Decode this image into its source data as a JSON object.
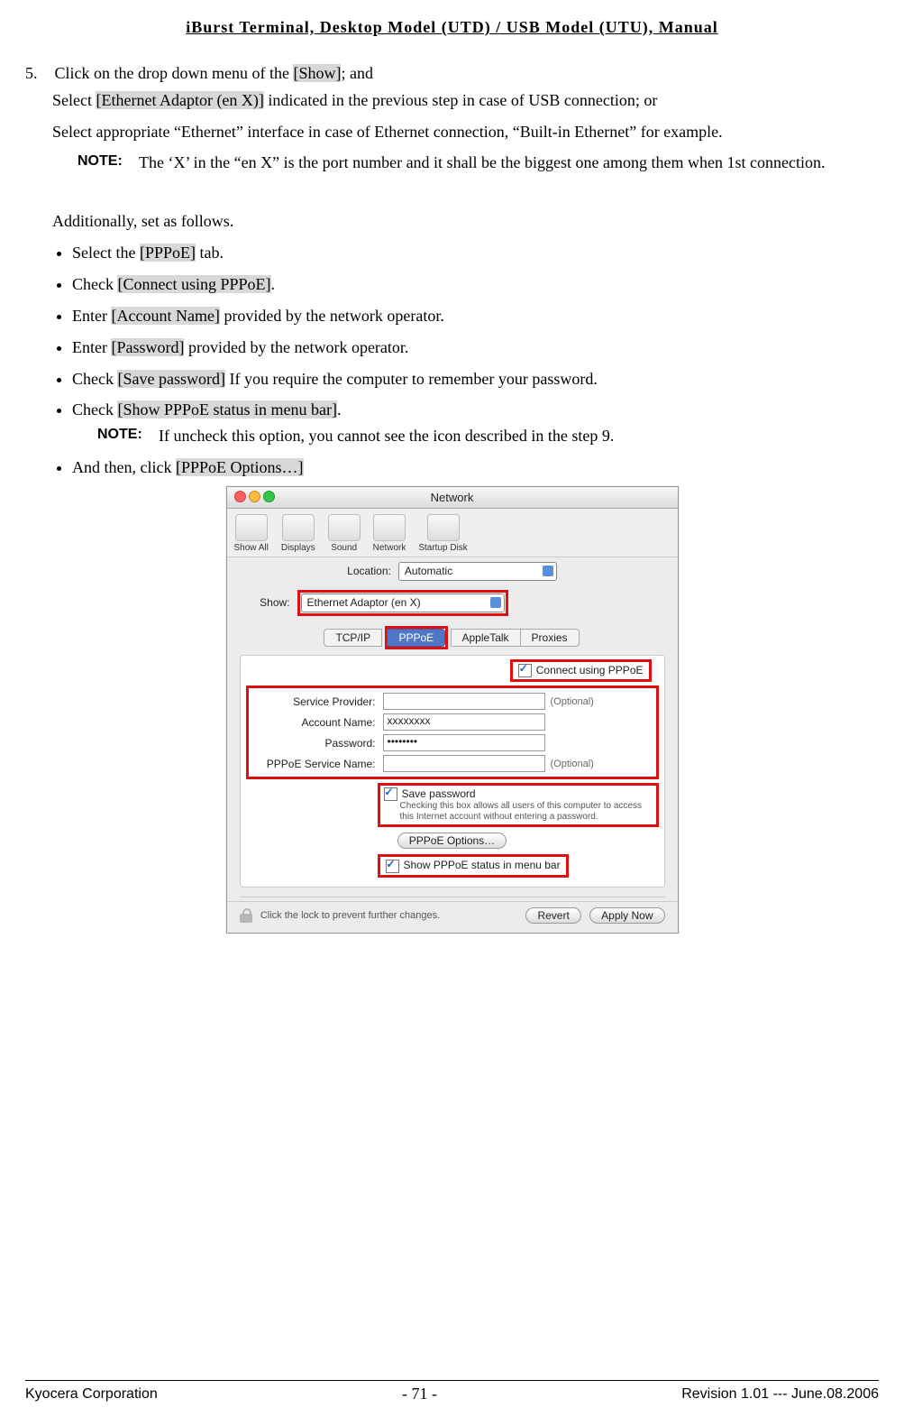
{
  "header": "iBurst Terminal, Desktop Model (UTD) / USB Model (UTU), Manual",
  "step_number": "5.",
  "step_text_1a": "Click on the drop down menu of the ",
  "step_text_1b": "[Show]",
  "step_text_1c": "; and",
  "step_text_2a": "Select ",
  "step_text_2b": "[Ethernet Adaptor (en X)]",
  "step_text_2c": " indicated in the previous step in case of USB connection; or",
  "step_text_3": "Select appropriate “Ethernet” interface in case of Ethernet connection, “Built-in Ethernet” for example.",
  "note_label": "NOTE:",
  "note_text": "The ‘X’ in the “en X” is the port number and it shall be the biggest one among them when 1st connection.",
  "additional": "Additionally, set as follows.",
  "bullets": {
    "b1a": "Select the ",
    "b1b": "[PPPoE]",
    "b1c": " tab.",
    "b2a": "Check ",
    "b2b": "[Connect using PPPoE]",
    "b2c": ".",
    "b3a": "Enter ",
    "b3b": "[Account Name]",
    "b3c": " provided by the network operator.",
    "b4a": "Enter ",
    "b4b": "[Password]",
    "b4c": " provided by the network operator.",
    "b5a": "Check ",
    "b5b": "[Save password]",
    "b5c": " If you require the computer to remember your password.",
    "b6a": "Check ",
    "b6b": "[Show PPPoE status in menu bar]",
    "b6c": ".",
    "b7a": "And then, click ",
    "b7b": "[PPPoE Options…]"
  },
  "inner_note": "If uncheck this option, you cannot see the icon described in the step 9.",
  "mac": {
    "title": "Network",
    "toolbar": [
      "Show All",
      "Displays",
      "Sound",
      "Network",
      "Startup Disk"
    ],
    "location_lbl": "Location:",
    "location_val": "Automatic",
    "show_lbl": "Show:",
    "show_val": "Ethernet Adaptor (en X)",
    "tabs": [
      "TCP/IP",
      "PPPoE",
      "AppleTalk",
      "Proxies"
    ],
    "active_tab": "PPPoE",
    "connect_chk": "Connect using PPPoE",
    "svc_lbl": "Service Provider:",
    "acct_lbl": "Account Name:",
    "acct_val": "xxxxxxxx",
    "pwd_lbl": "Password:",
    "pwd_val": "••••••••",
    "pppoe_svc_lbl": "PPPoE Service Name:",
    "optional": "(Optional)",
    "save_pwd": "Save password",
    "save_hint": "Checking this box allows all users of this computer to access this Internet account without entering a password.",
    "options_btn": "PPPoE Options…",
    "show_status": "Show PPPoE status in menu bar",
    "lock_text": "Click the lock to prevent further changes.",
    "revert": "Revert",
    "apply": "Apply Now"
  },
  "footer": {
    "left": "Kyocera Corporation",
    "center": "- 71 -",
    "right": "Revision 1.01 --- June.08.2006"
  }
}
